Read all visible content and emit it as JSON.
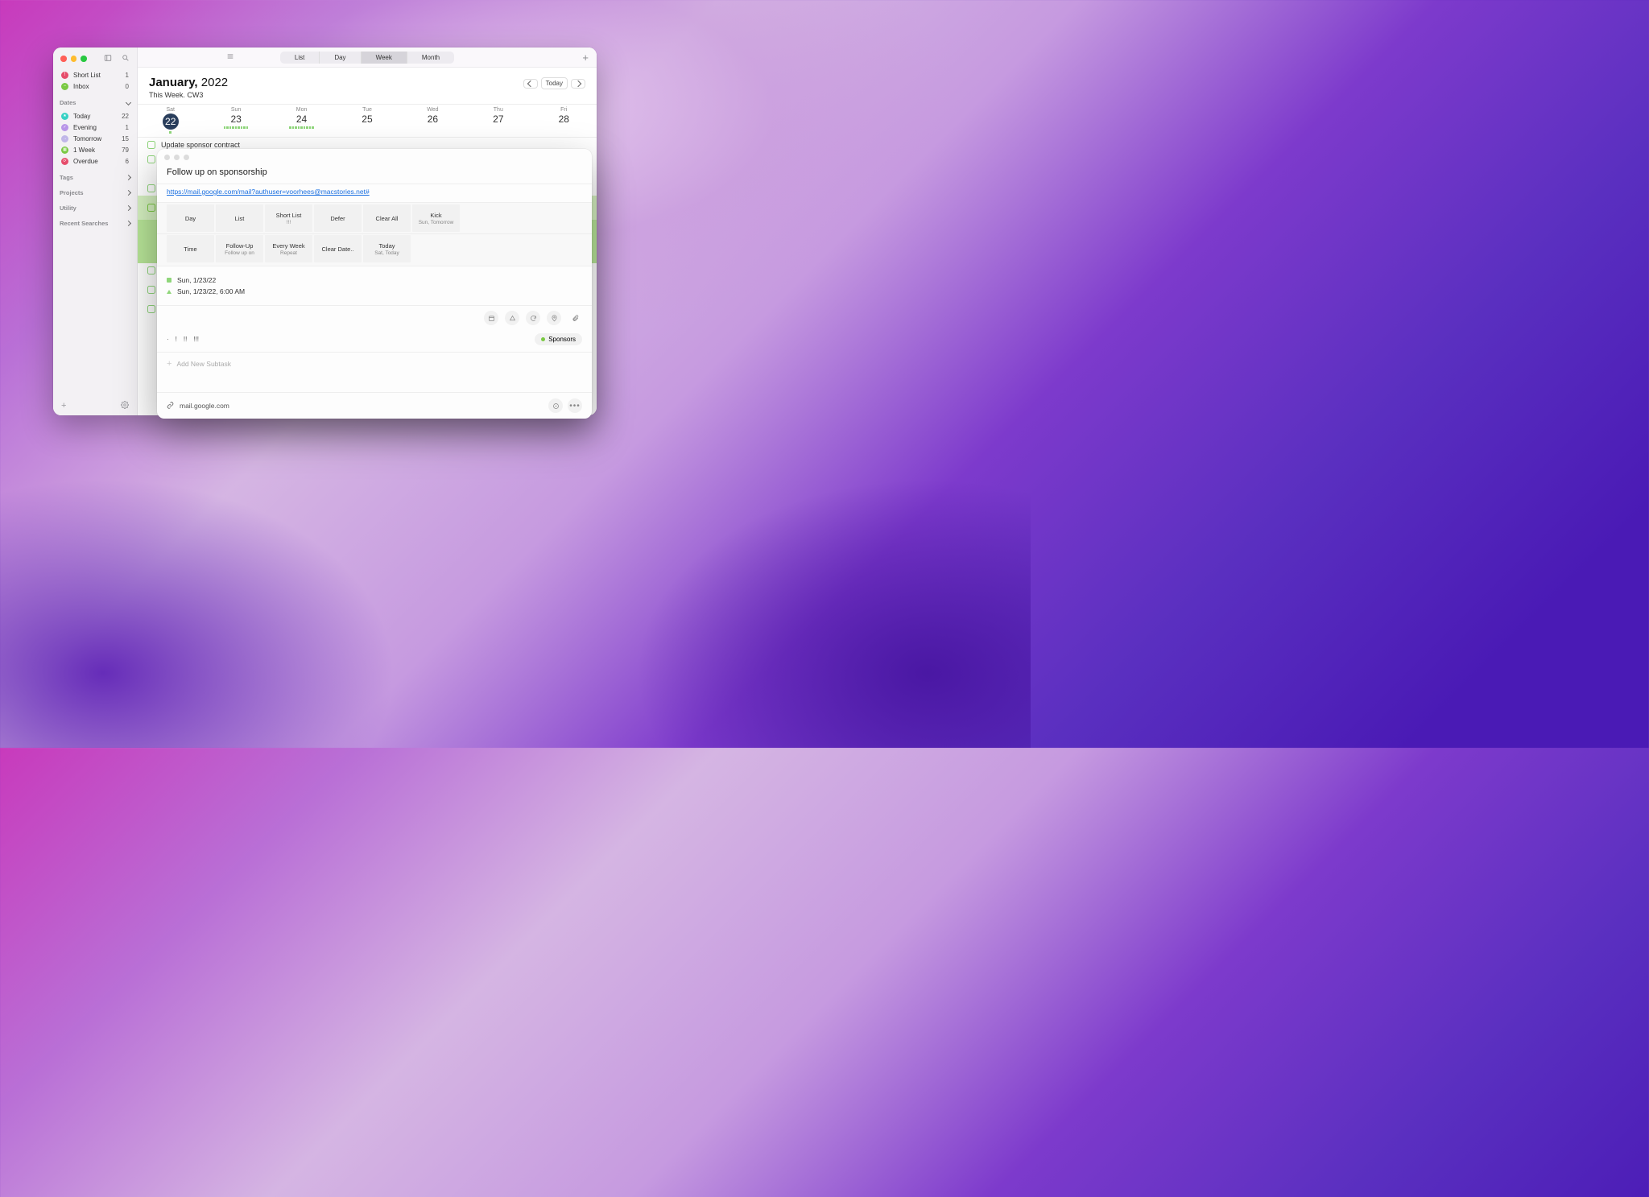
{
  "sidebar": {
    "smart": [
      {
        "label": "Short List",
        "count": "1",
        "color": "#e64d6b"
      },
      {
        "label": "Inbox",
        "count": "0",
        "color": "#7ac943"
      }
    ],
    "dates_header": "Dates",
    "dates": [
      {
        "label": "Today",
        "count": "22",
        "color": "#36d1c4"
      },
      {
        "label": "Evening",
        "count": "1",
        "color": "#b895e8"
      },
      {
        "label": "Tomorrow",
        "count": "15",
        "color": "#c0b6e8"
      },
      {
        "label": "1 Week",
        "count": "79",
        "color": "#7ac943"
      },
      {
        "label": "Overdue",
        "count": "6",
        "color": "#e64d6b"
      }
    ],
    "sections": [
      "Tags",
      "Projects",
      "Utility",
      "Recent Searches"
    ]
  },
  "toolbar": {
    "segments": [
      "List",
      "Day",
      "Week",
      "Month"
    ],
    "active": "Week"
  },
  "calendar": {
    "month": "January,",
    "year": "2022",
    "subtitle": "This Week. CW3",
    "today_btn": "Today",
    "days": [
      {
        "name": "Sat",
        "num": "22",
        "today": true,
        "dots": 1
      },
      {
        "name": "Sun",
        "num": "23",
        "dots": 9
      },
      {
        "name": "Mon",
        "num": "24",
        "dots": 9
      },
      {
        "name": "Tue",
        "num": "25",
        "dots": 0
      },
      {
        "name": "Wed",
        "num": "26",
        "dots": 0
      },
      {
        "name": "Thu",
        "num": "27",
        "dots": 0
      },
      {
        "name": "Fri",
        "num": "28",
        "dots": 0
      }
    ]
  },
  "tasks": [
    {
      "title": "Update sponsor contract"
    }
  ],
  "detail": {
    "title": "Follow up on sponsorship",
    "link": "https://mail.google.com/mail?authuser=voorhees@macstories.net#",
    "actions_row1": [
      {
        "label": "Day",
        "sub": ""
      },
      {
        "label": "List",
        "sub": ""
      },
      {
        "label": "Short List",
        "sub": "!!!"
      },
      {
        "label": "Defer",
        "sub": ""
      },
      {
        "label": "Clear All",
        "sub": ""
      },
      {
        "label": "Kick",
        "sub": "Sun, Tomorrow"
      }
    ],
    "actions_row2": [
      {
        "label": "Time",
        "sub": ""
      },
      {
        "label": "Follow-Up",
        "sub": "Follow up on"
      },
      {
        "label": "Every Week",
        "sub": "Repeat"
      },
      {
        "label": "Clear Date..",
        "sub": ""
      },
      {
        "label": "Today",
        "sub": "Sat, Today"
      }
    ],
    "date_line": "Sun, 1/23/22",
    "alarm_line": "Sun, 1/23/22, 6:00 AM",
    "priority": [
      "·",
      "!",
      "!!",
      "!!!"
    ],
    "tag": "Sponsors",
    "subtask_placeholder": "Add New Subtask",
    "footer_domain": "mail.google.com"
  }
}
